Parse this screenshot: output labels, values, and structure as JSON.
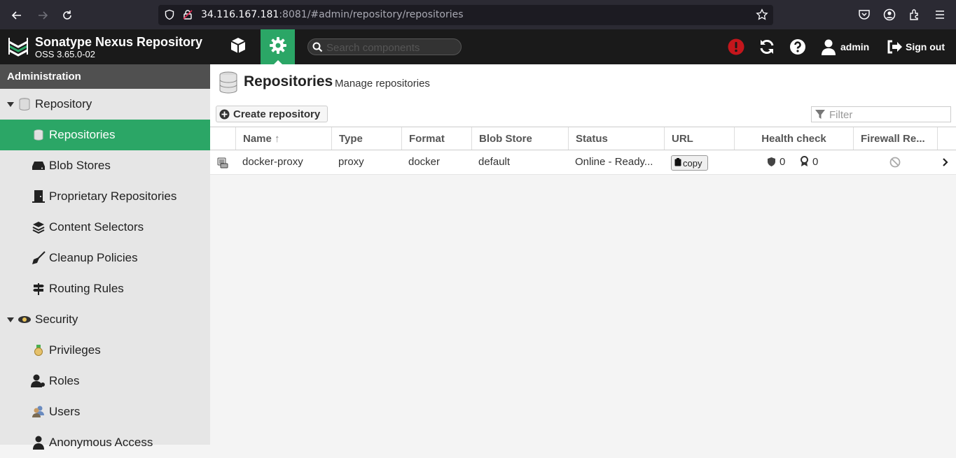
{
  "browser": {
    "url_host": "34.116.167.181",
    "url_rest": ":8081/#admin/repository/repositories"
  },
  "header": {
    "title": "Sonatype Nexus Repository",
    "version": "OSS 3.65.0-02",
    "search_placeholder": "Search components",
    "user": "admin",
    "signout": "Sign out"
  },
  "sidebar": {
    "heading": "Administration",
    "items": [
      {
        "label": "Repository",
        "icon": "database-icon"
      },
      {
        "label": "Repositories",
        "icon": "database-icon"
      },
      {
        "label": "Blob Stores",
        "icon": "hdd-icon"
      },
      {
        "label": "Proprietary Repositories",
        "icon": "door-icon"
      },
      {
        "label": "Content Selectors",
        "icon": "layers-icon"
      },
      {
        "label": "Cleanup Policies",
        "icon": "broom-icon"
      },
      {
        "label": "Routing Rules",
        "icon": "signpost-icon"
      },
      {
        "label": "Security",
        "icon": "police-icon"
      },
      {
        "label": "Privileges",
        "icon": "medal-icon"
      },
      {
        "label": "Roles",
        "icon": "user-key-icon"
      },
      {
        "label": "Users",
        "icon": "users-icon"
      },
      {
        "label": "Anonymous Access",
        "icon": "user-icon"
      }
    ]
  },
  "main": {
    "title": "Repositories",
    "subtitle": "Manage repositories",
    "create_label": "Create repository",
    "filter_placeholder": "Filter",
    "columns": [
      "Name",
      "Type",
      "Format",
      "Blob Store",
      "Status",
      "URL",
      "Health check",
      "Firewall Re..."
    ],
    "rows": [
      {
        "name": "docker-proxy",
        "type": "proxy",
        "format": "docker",
        "blob_store": "default",
        "status": "Online - Ready...",
        "url_button": "copy",
        "health_security": "0",
        "health_license": "0"
      }
    ]
  },
  "colors": {
    "accent": "#2ba666",
    "header_bg": "#1a1a1a",
    "alert": "#c4161c"
  }
}
